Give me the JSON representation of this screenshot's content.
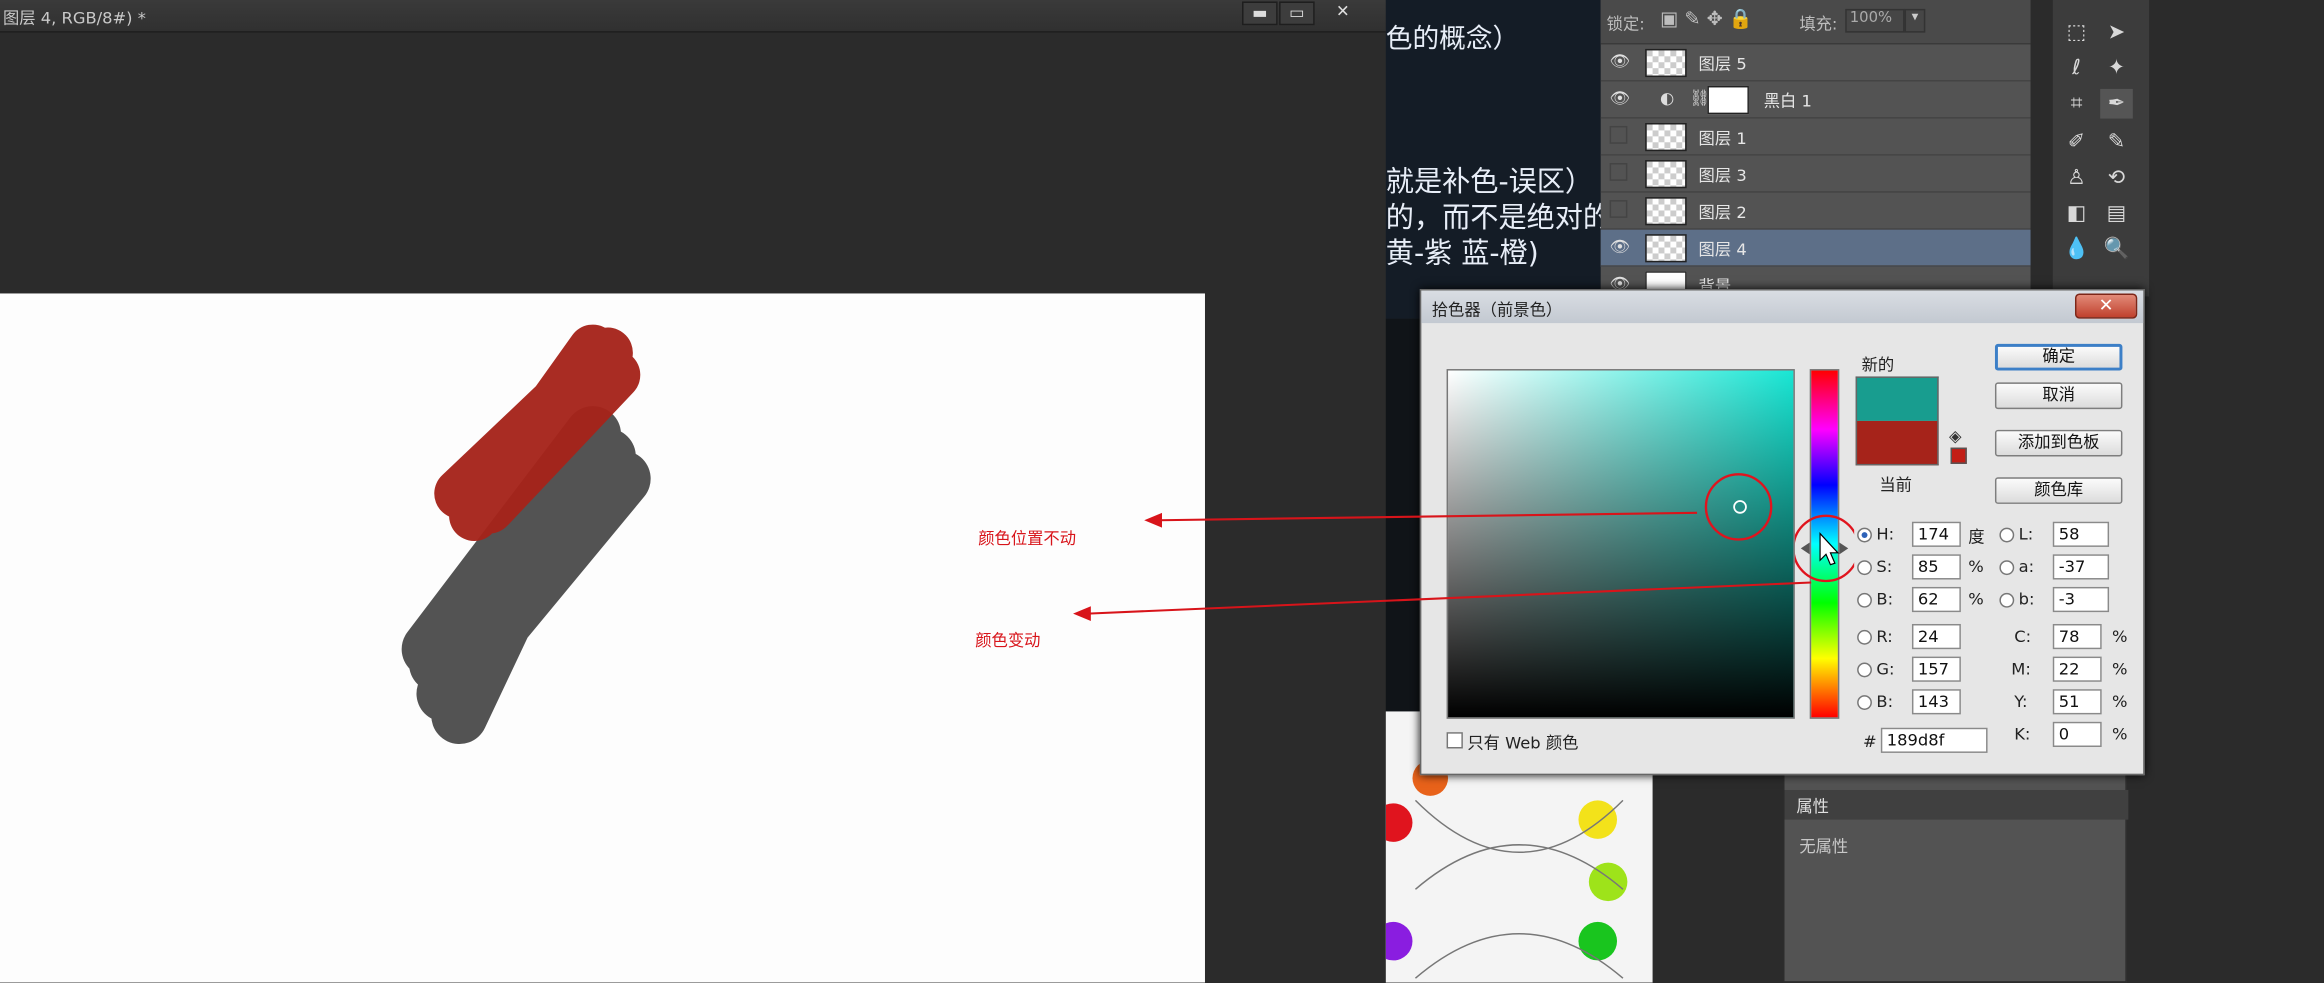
{
  "document": {
    "title": "图层 4, RGB/8#) *",
    "window_buttons": [
      "▬",
      "▭",
      "✕"
    ],
    "annotations": {
      "position_fixed": "颜色位置不动",
      "color_changes": "颜色变动"
    },
    "stroke_colors": {
      "red": "#a6231a",
      "gray": "#4d4d4d"
    }
  },
  "slide": {
    "line1": "色的概念）",
    "line2": "就是补色-误区）",
    "line3": "的，而不是绝对的",
    "line4": "黄-紫 蓝-橙)"
  },
  "layers": {
    "lock_label": "锁定:",
    "fill_label": "填充:",
    "fill_value": "100%",
    "items": [
      {
        "name": "图层 5",
        "visible": true,
        "selected": false
      },
      {
        "name": "黑白 1",
        "visible": true,
        "selected": false
      },
      {
        "name": "图层 1",
        "visible": false,
        "selected": false
      },
      {
        "name": "图层 3",
        "visible": false,
        "selected": false
      },
      {
        "name": "图层 2",
        "visible": false,
        "selected": false
      },
      {
        "name": "图层 4",
        "visible": true,
        "selected": true
      },
      {
        "name": "背景",
        "visible": true,
        "selected": false
      }
    ]
  },
  "properties": {
    "tab": "属性",
    "body": "无属性"
  },
  "color_picker": {
    "title": "拾色器（前景色）",
    "new_label": "新的",
    "current_label": "当前",
    "new_color": "#189d8f",
    "current_color": "#a6231a",
    "buttons": {
      "ok": "确定",
      "cancel": "取消",
      "add_swatch": "添加到色板",
      "libraries": "颜色库"
    },
    "hsb": {
      "h_label": "H:",
      "h": "174",
      "h_unit": "度",
      "s_label": "S:",
      "s": "85",
      "s_unit": "%",
      "b_label": "B:",
      "b": "62",
      "b_unit": "%"
    },
    "rgb": {
      "r_label": "R:",
      "r": "24",
      "g_label": "G:",
      "g": "157",
      "b_label": "B:",
      "b": "143"
    },
    "lab": {
      "l_label": "L:",
      "l": "58",
      "a_label": "a:",
      "a": "-37",
      "b_label": "b:",
      "b": "-3"
    },
    "cmyk": {
      "c_label": "C:",
      "c": "78",
      "m_label": "M:",
      "m": "22",
      "y_label": "Y:",
      "y": "51",
      "k_label": "K:",
      "k": "0",
      "unit": "%"
    },
    "hex_label": "#",
    "hex": "189d8f",
    "web_only_label": "只有 Web 颜色"
  }
}
